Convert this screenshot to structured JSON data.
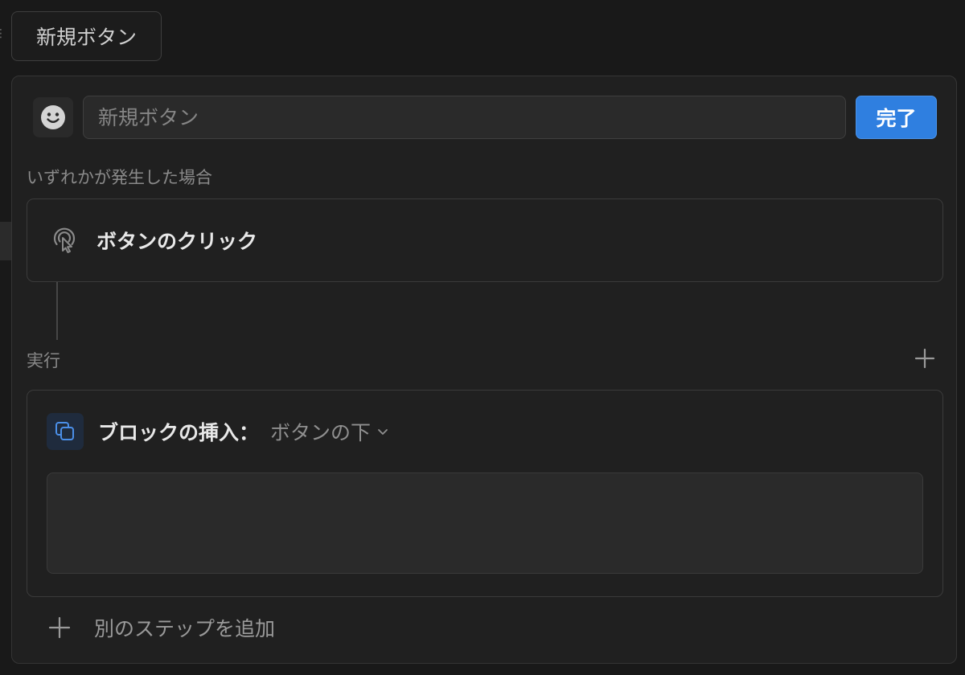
{
  "top_button": {
    "label": "新規ボタン"
  },
  "editor": {
    "name_input": {
      "value": "",
      "placeholder": "新規ボタン"
    },
    "done_label": "完了",
    "trigger_section_label": "いずれかが発生した場合",
    "trigger": {
      "label": "ボタンのクリック",
      "icon": "click-pointer-icon"
    },
    "exec_section_label": "実行",
    "action": {
      "title": "ブロックの挿入：",
      "position_value": "ボタンの下",
      "icon": "copy-blocks-icon"
    },
    "add_step_label": "別のステップを追加"
  },
  "colors": {
    "accent": "#2f7fe0",
    "background": "#191919",
    "panel": "#202020"
  }
}
